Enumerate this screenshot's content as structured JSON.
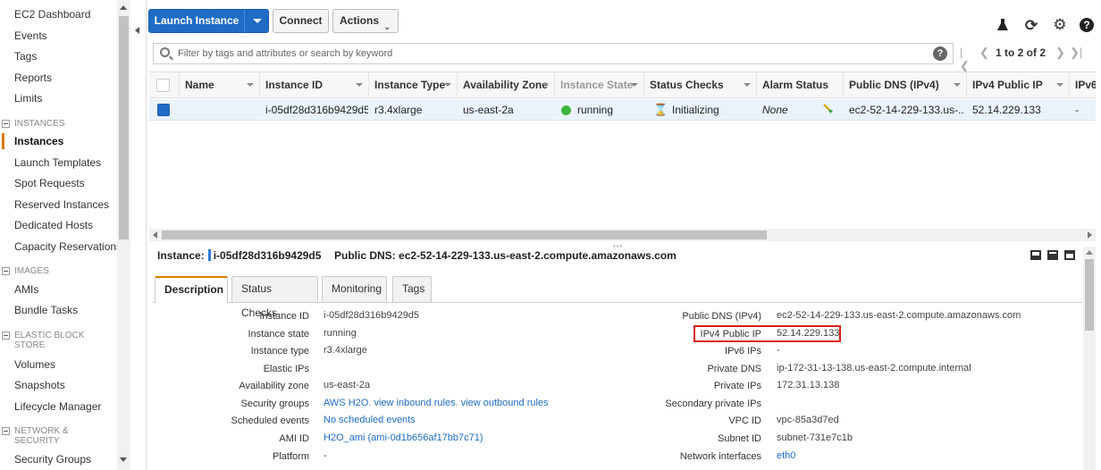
{
  "sidebar": {
    "items_top": [
      "EC2 Dashboard",
      "Events",
      "Tags",
      "Reports",
      "Limits"
    ],
    "sections": [
      {
        "title": "INSTANCES",
        "items": [
          "Instances",
          "Launch Templates",
          "Spot Requests",
          "Reserved Instances",
          "Dedicated Hosts",
          "Capacity Reservations"
        ]
      },
      {
        "title": "IMAGES",
        "items": [
          "AMIs",
          "Bundle Tasks"
        ]
      },
      {
        "title": "ELASTIC BLOCK STORE",
        "items": [
          "Volumes",
          "Snapshots",
          "Lifecycle Manager"
        ]
      },
      {
        "title": "NETWORK & SECURITY",
        "items": [
          "Security Groups"
        ]
      }
    ],
    "active_item": "Instances",
    "accent_color": "#e07b00"
  },
  "toolbar": {
    "launch_label": "Launch Instance",
    "connect_label": "Connect",
    "actions_label": "Actions",
    "primary_color": "#1f6cc4",
    "icons": [
      "flask-icon",
      "refresh-icon",
      "gear-icon",
      "help-icon"
    ]
  },
  "search": {
    "placeholder": "Filter by tags and attributes or search by keyword"
  },
  "pager": {
    "text": "1 to 2 of 2"
  },
  "grid": {
    "columns": [
      "Name",
      "Instance ID",
      "Instance Type",
      "Availability Zone",
      "Instance State",
      "Status Checks",
      "Alarm Status",
      "Public DNS (IPv4)",
      "IPv4 Public IP",
      "IPv6"
    ],
    "rows": [
      {
        "name": "",
        "instance_id": "i-05df28d316b9429d5",
        "instance_type": "r3.4xlarge",
        "az": "us-east-2a",
        "state": "running",
        "status_checks": "Initializing",
        "alarm_status": "None",
        "public_dns": "ec2-52-14-229-133.us-...",
        "public_ip": "52.14.229.133",
        "ipv6": "-"
      }
    ]
  },
  "detail": {
    "instance_label": "Instance:",
    "instance_id": "i-05df28d316b9429d5",
    "dns_label": "Public DNS:",
    "dns_value": "ec2-52-14-229-133.us-east-2.compute.amazonaws.com",
    "tabs": [
      "Description",
      "Status Checks",
      "Monitoring",
      "Tags"
    ],
    "left_props": [
      {
        "label": "Instance ID",
        "value": "i-05df28d316b9429d5"
      },
      {
        "label": "Instance state",
        "value": "running"
      },
      {
        "label": "Instance type",
        "value": "r3.4xlarge"
      },
      {
        "label": "Elastic IPs",
        "value": ""
      },
      {
        "label": "Availability zone",
        "value": "us-east-2a"
      },
      {
        "label": "Security groups",
        "value": "AWS H2O",
        "links": [
          "view inbound rules",
          "view outbound rules"
        ]
      },
      {
        "label": "Scheduled events",
        "value": "No scheduled events"
      },
      {
        "label": "AMI ID",
        "value": "H2O_ami (ami-0d1b656af17bb7c71)"
      },
      {
        "label": "Platform",
        "value": "-"
      }
    ],
    "right_props": [
      {
        "label": "Public DNS (IPv4)",
        "value": "ec2-52-14-229-133.us-east-2.compute.amazonaws.com"
      },
      {
        "label": "IPv4 Public IP",
        "value": "52.14.229.133"
      },
      {
        "label": "IPv6 IPs",
        "value": "-"
      },
      {
        "label": "Private DNS",
        "value": "ip-172-31-13-138.us-east-2.compute.internal"
      },
      {
        "label": "Private IPs",
        "value": "172.31.13.138"
      },
      {
        "label": "Secondary private IPs",
        "value": ""
      },
      {
        "label": "VPC ID",
        "value": "vpc-85a3d7ed"
      },
      {
        "label": "Subnet ID",
        "value": "subnet-731e7c1b"
      },
      {
        "label": "Network interfaces",
        "value": "eth0"
      }
    ],
    "highlight_color": "#d81e1e"
  }
}
